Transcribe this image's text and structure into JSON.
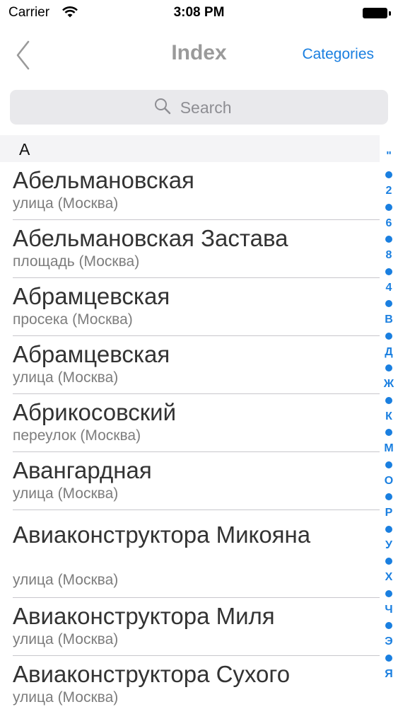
{
  "status": {
    "carrier": "Carrier",
    "time": "3:08 PM"
  },
  "nav": {
    "title": "Index",
    "right_label": "Categories"
  },
  "search": {
    "placeholder": "Search"
  },
  "section": {
    "letter": "А"
  },
  "rows": [
    {
      "title": "Абельмановская",
      "sub": "улица (Москва)"
    },
    {
      "title": "Абельмановская Застава",
      "sub": "площадь (Москва)"
    },
    {
      "title": "Абрамцевская",
      "sub": "просека (Москва)"
    },
    {
      "title": "Абрамцевская",
      "sub": "улица (Москва)"
    },
    {
      "title": "Абрикосовский",
      "sub": "переулок (Москва)"
    },
    {
      "title": "Авангардная",
      "sub": "улица (Москва)"
    },
    {
      "title": "Авиаконструктора Микояна",
      "sub": "улица (Москва)"
    },
    {
      "title": "Авиаконструктора Миля",
      "sub": "улица (Москва)"
    },
    {
      "title": "Авиаконструктора Сухого",
      "sub": "улица (Москва)"
    }
  ],
  "index": {
    "letters": [
      "\"",
      "2",
      "6",
      "8",
      "4",
      "В",
      "Д",
      "Ж",
      "К",
      "М",
      "О",
      "Р",
      "У",
      "Х",
      "Ч",
      "Э",
      "Я"
    ]
  },
  "colors": {
    "accent": "#1a7fe0",
    "title_gray": "#9a9a9a",
    "header_bg": "#f4f4f6"
  }
}
